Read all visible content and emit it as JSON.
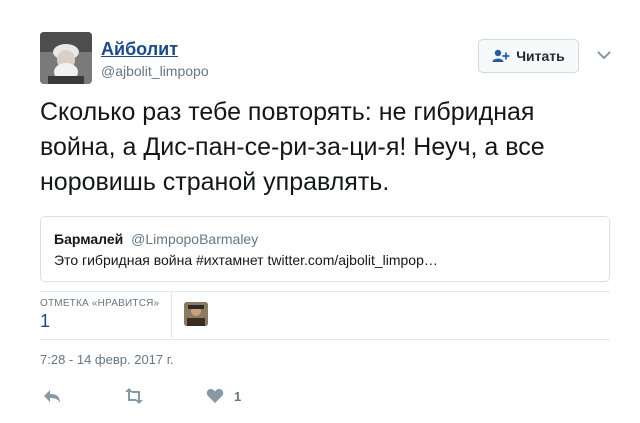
{
  "header": {
    "display_name": "Айболит",
    "handle": "@ajbolit_limpopo",
    "follow_label": "Читать"
  },
  "tweet": {
    "text": "Сколько раз тебе повторять: не гибридная война, а Дис-пан-се-ри-за-ци-я! Неуч, а все норовишь страной управлять."
  },
  "quote": {
    "name": "Бармалей",
    "handle": "@LimpopoBarmaley",
    "text": "Это гибридная война #ихтамнет twitter.com/ajbolit_limpop…"
  },
  "stats": {
    "likes_label": "ОТМЕТКА «НРАВИТСЯ»",
    "likes_count": "1"
  },
  "timestamp": "7:28 - 14 февр. 2017 г.",
  "actions": {
    "like_count": "1"
  },
  "colors": {
    "link": "#1b4a8a",
    "muted": "#657786",
    "border": "#e1e8ed"
  }
}
